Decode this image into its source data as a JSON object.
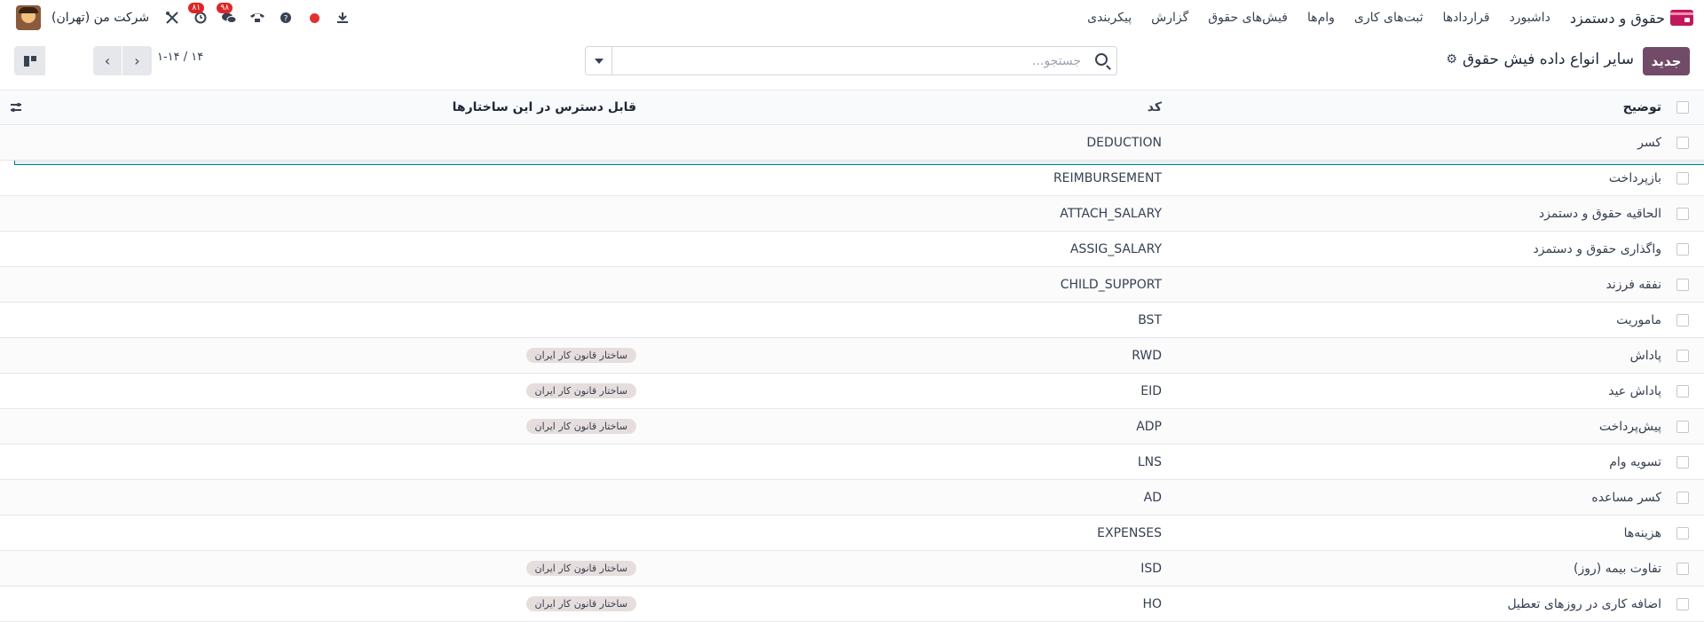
{
  "navbar": {
    "app_name": "حقوق و دستمزد",
    "menu": [
      "داشبورد",
      "قراردادها",
      "ثبت‌های کاری",
      "وام‌ها",
      "فیش‌های حقوق",
      "گزارش",
      "پیکربندی"
    ],
    "company": "شرکت من (تهران)",
    "activity_badge": "۸۱",
    "messages_badge": "۹۸"
  },
  "control_panel": {
    "new_button": "جدید",
    "title": "سایر انواع داده فیش حقوق",
    "search_placeholder": "جستجو...",
    "pager": "۱-۱۴ / ۱۴"
  },
  "table": {
    "headers": {
      "description": "توضیح",
      "code": "کد",
      "structures": "قابل دسترس در این ساختارها"
    },
    "rows": [
      {
        "description": "کسر",
        "code": "DEDUCTION",
        "structure": ""
      },
      {
        "description": "بازپرداخت",
        "code": "REIMBURSEMENT",
        "structure": ""
      },
      {
        "description": "الحاقیه حقوق و دستمزد",
        "code": "ATTACH_SALARY",
        "structure": ""
      },
      {
        "description": "واگذاری حقوق و دستمزد",
        "code": "ASSIG_SALARY",
        "structure": ""
      },
      {
        "description": "نفقه فرزند",
        "code": "CHILD_SUPPORT",
        "structure": ""
      },
      {
        "description": "ماموریت",
        "code": "BST",
        "structure": ""
      },
      {
        "description": "پاداش",
        "code": "RWD",
        "structure": "ساختار قانون کار ایران"
      },
      {
        "description": "پاداش عید",
        "code": "EID",
        "structure": "ساختار قانون کار ایران"
      },
      {
        "description": "پیش‌پرداخت",
        "code": "ADP",
        "structure": "ساختار قانون کار ایران"
      },
      {
        "description": "تسویه وام",
        "code": "LNS",
        "structure": ""
      },
      {
        "description": "کسر مساعده",
        "code": "AD",
        "structure": ""
      },
      {
        "description": "هزینه‌ها",
        "code": "EXPENSES",
        "structure": ""
      },
      {
        "description": "تفاوت بیمه (روز)",
        "code": "ISD",
        "structure": "ساختار قانون کار ایران"
      },
      {
        "description": "اضافه کاری در روزهای تعطیل",
        "code": "HO",
        "structure": "ساختار قانون کار ایران"
      }
    ]
  },
  "colors": {
    "primary": "#714b67",
    "accent": "#017e84",
    "badge": "#dc2626"
  },
  "icons": [
    "payroll-app-icon",
    "download-icon",
    "recording-dot-icon",
    "help-icon",
    "phone-icon",
    "chat-icon",
    "clock-icon",
    "tools-icon",
    "search-icon",
    "settings-gear-icon",
    "chevron-left-icon",
    "chevron-right-icon",
    "list-view-icon",
    "kanban-view-icon",
    "optional-columns-icon"
  ]
}
